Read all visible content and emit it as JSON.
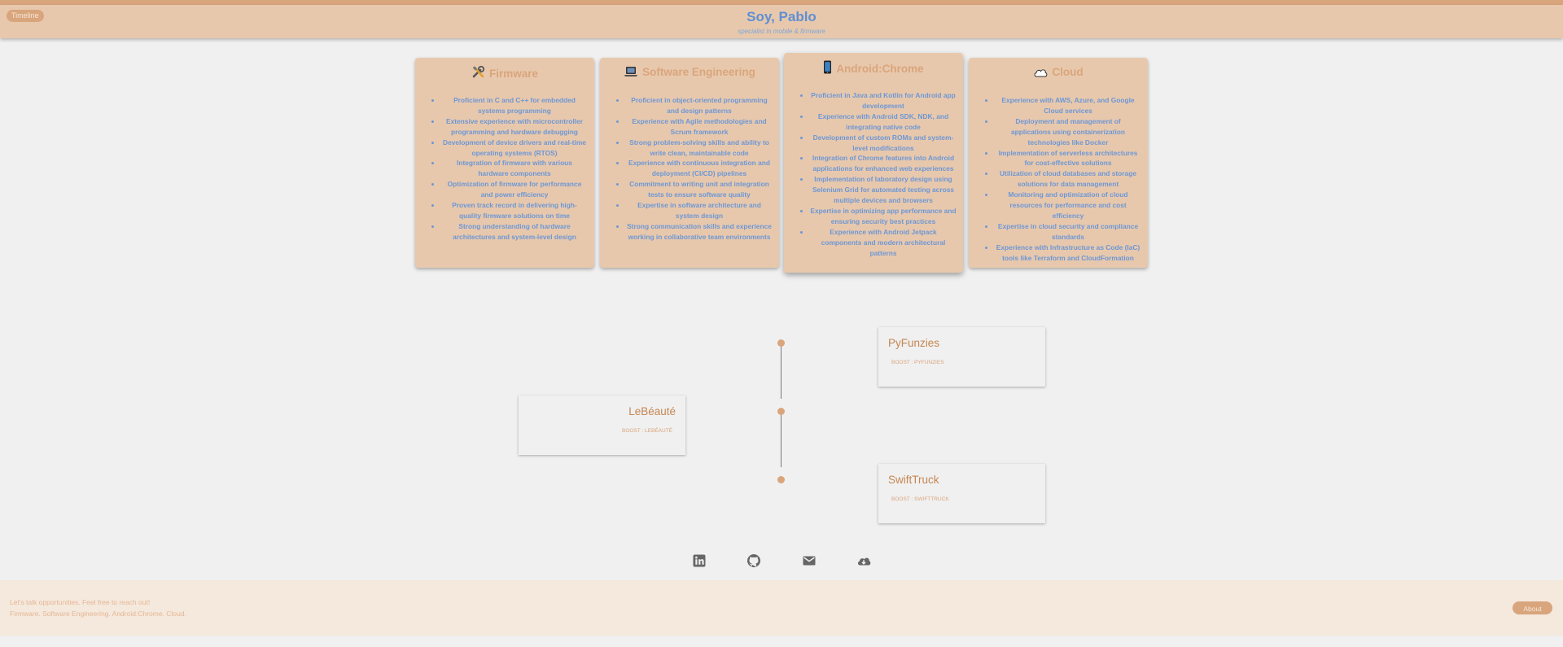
{
  "header": {
    "timeline_label": "Timeline",
    "title": "Soy, Pablo",
    "subtitle": "specialist in mobile & firmware"
  },
  "cards": [
    {
      "icon": "tools-icon",
      "title": "Firmware",
      "items": [
        "Proficient in C and C++ for embedded systems programming",
        "Extensive experience with microcontroller programming and hardware debugging",
        "Development of device drivers and real-time operating systems (RTOS)",
        "Integration of firmware with various hardware components",
        "Optimization of firmware for performance and power efficiency",
        "Proven track record in delivering high-quality firmware solutions on time",
        "Strong understanding of hardware architectures and system-level design"
      ]
    },
    {
      "icon": "laptop-icon",
      "title": "Software Engineering",
      "items": [
        "Proficient in object-oriented programming and design patterns",
        "Experience with Agile methodologies and Scrum framework",
        "Strong problem-solving skills and ability to write clean, maintainable code",
        "Experience with continuous integration and deployment (CI/CD) pipelines",
        "Commitment to writing unit and integration tests to ensure software quality",
        "Expertise in software architecture and system design",
        "Strong communication skills and experience working in collaborative team environments"
      ]
    },
    {
      "icon": "mobile-phone-icon",
      "title": "Android:Chrome",
      "items": [
        "Proficient in Java and Kotlin for Android app development",
        "Experience with Android SDK, NDK, and integrating native code",
        "Development of custom ROMs and system-level modifications",
        "Integration of Chrome features into Android applications for enhanced web experiences",
        "Implementation of laboratory design using Selenium Grid for automated testing across multiple devices and browsers",
        "Expertise in optimizing app performance and ensuring security best practices",
        "Experience with Android Jetpack components and modern architectural patterns"
      ]
    },
    {
      "icon": "cloud-icon",
      "title": "Cloud",
      "items": [
        "Experience with AWS, Azure, and Google Cloud services",
        "Deployment and management of applications using containerization technologies like Docker",
        "Implementation of serverless architectures for cost-effective solutions",
        "Utilization of cloud databases and storage solutions for data management",
        "Monitoring and optimization of cloud resources for performance and cost efficiency",
        "Expertise in cloud security and compliance standards",
        "Experience with Infrastructure as Code (IaC) tools like Terraform and CloudFormation"
      ]
    }
  ],
  "timeline": [
    {
      "name": "PyFunzies",
      "boost": "BOOST : PYFUNZIES"
    },
    {
      "name": "LeBéauté",
      "boost": "BOOST : LEBÉAUTÉ"
    },
    {
      "name": "SwiftTruck",
      "boost": "BOOST : SWIFTTRUCK"
    }
  ],
  "social": [
    "linkedin-icon",
    "github-icon",
    "mail-icon",
    "cloud-download-icon"
  ],
  "footer": {
    "line1": "Let's talk opportunities. Feel free to reach out!",
    "line2": "Firmware. Software Engineering. Android:Chrome. Cloud.",
    "about_label": "About"
  },
  "colors": {
    "accent": "#d9a57c",
    "header_bg": "#e8c8ac",
    "text_blue": "#5f8fd2",
    "background": "#f0f0f0"
  }
}
